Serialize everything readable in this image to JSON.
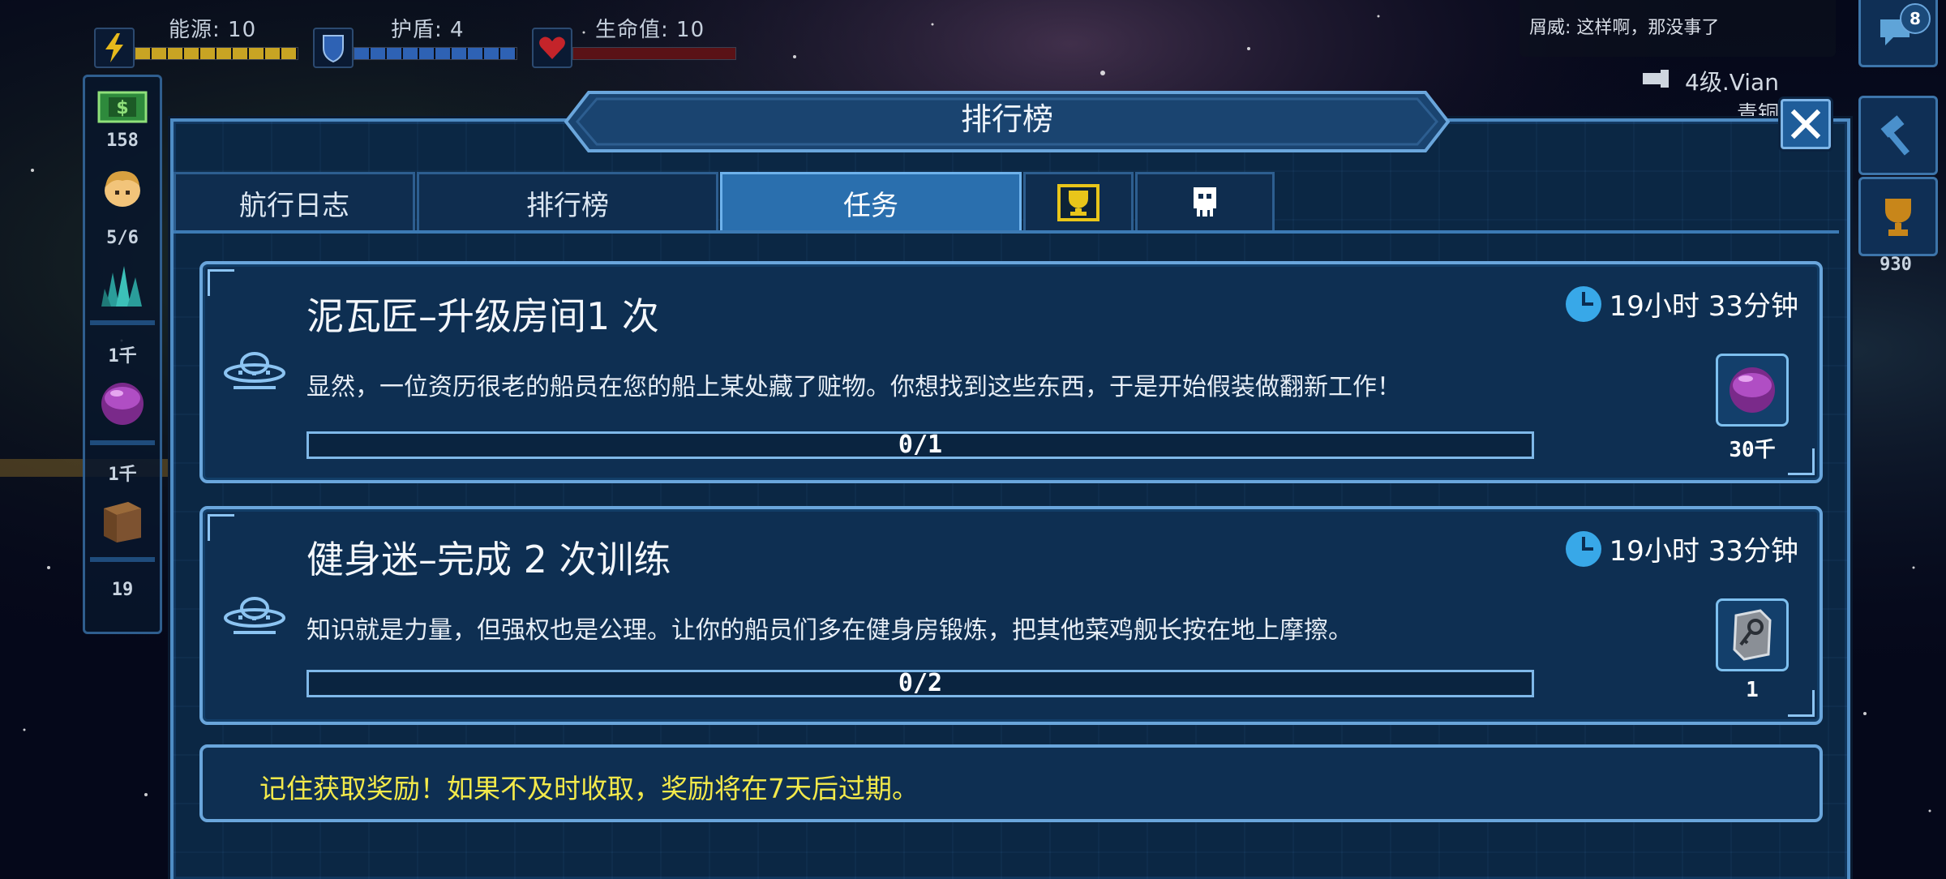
{
  "hud": {
    "energy": {
      "label": "能源: 10",
      "fill": 1.0
    },
    "shield": {
      "label": "护盾: 4",
      "fill": 1.0
    },
    "hp": {
      "label": "生命值: 10",
      "fill": 0.0
    }
  },
  "chat": {
    "message": "屑威: 这样啊，那没事了",
    "badge": "8"
  },
  "player": {
    "level_name": "4级.Vian",
    "sub_label": "青铜"
  },
  "resources": {
    "crew": "158",
    "crew_capacity": "5/6",
    "mineral": "1千",
    "gas": "1千",
    "supply": "19"
  },
  "trophy_count": "930",
  "panel": {
    "title": "排行榜",
    "tabs": [
      {
        "label": "航行日志",
        "active": false
      },
      {
        "label": "排行榜",
        "active": false
      },
      {
        "label": "任务",
        "active": true
      }
    ]
  },
  "quests": [
    {
      "title": "泥瓦匠–升级房间1 次",
      "description": "显然，一位资历很老的船员在您的船上某处藏了赃物。你想找到这些东西，于是开始假装做翻新工作！",
      "progress_text": "0/1",
      "progress": 0.0,
      "time_left": "19小时 33分钟",
      "reward_amount": "30千",
      "reward_icon": "purple-gas-orb-icon"
    },
    {
      "title": "健身迷–完成 2 次训练",
      "description": "知识就是力量，但强权也是公理。让你的船员们多在健身房锻炼，把其他菜鸡舰长按在地上摩擦。",
      "progress_text": "0/2",
      "progress": 0.0,
      "time_left": "19小时 33分钟",
      "reward_amount": "1",
      "reward_icon": "key-card-icon"
    }
  ],
  "notice": "记住获取奖励！如果不及时收取，奖励将在7天后过期。",
  "colors": {
    "panel_bg": "#0b2744",
    "panel_border": "#4f8cc4",
    "active_tab": "#2a6fae",
    "notice_text": "#f3e94a",
    "energy": "#c8a423",
    "shield": "#2e62b4",
    "hp": "#9e1f22"
  }
}
